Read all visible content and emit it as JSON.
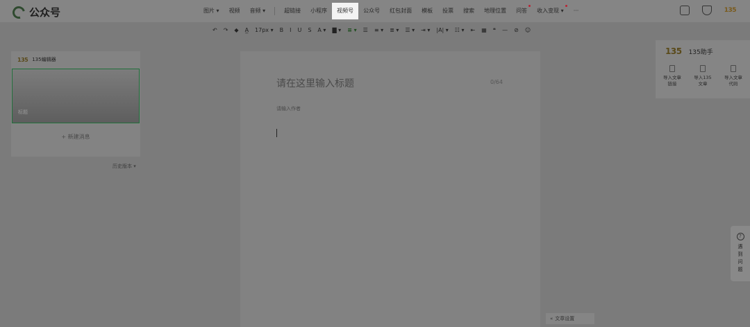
{
  "app": {
    "title": "公众号"
  },
  "menu": {
    "items": [
      {
        "label": "图片",
        "caret": true
      },
      {
        "label": "视频"
      },
      {
        "label": "音频",
        "caret": true
      }
    ],
    "items2": [
      {
        "label": "超链接"
      },
      {
        "label": "小程序"
      },
      {
        "label": "视频号",
        "active": true
      },
      {
        "label": "公众号"
      },
      {
        "label": "红包封面"
      },
      {
        "label": "模板"
      },
      {
        "label": "投票"
      },
      {
        "label": "搜索"
      },
      {
        "label": "地理位置"
      },
      {
        "label": "问答",
        "dot": true
      },
      {
        "label": "收入变现",
        "caret": true,
        "dot": true
      },
      {
        "label": "···"
      }
    ]
  },
  "topright": {
    "brand": "135"
  },
  "toolbar": {
    "font_size": "17px",
    "items": [
      "↶",
      "↷",
      "◆",
      "A̲",
      "17px ▾",
      "B",
      "I",
      "U",
      "S",
      "A ▾",
      "▇ ▾",
      "≡ ▾",
      "☰",
      "≡ ▾",
      "≣ ▾",
      "☰ ▾",
      "⇥ ▾",
      "|A| ▾",
      "☷ ▾",
      "⇤",
      "▦",
      "❝",
      "—",
      "⊘",
      "☺"
    ]
  },
  "left_panel": {
    "brand": "135",
    "header": "135编辑器",
    "card_label": "标题",
    "new_message": "+ 新建消息",
    "history": "历史版本 ▾"
  },
  "editor": {
    "title_placeholder": "请在这里输入标题",
    "title_count": "0/64",
    "author_placeholder": "请输入作者"
  },
  "assistant": {
    "brand": "135",
    "title": "135助手",
    "items": [
      {
        "line1": "导入文章",
        "line2": "链接"
      },
      {
        "line1": "导入135",
        "line2": "文章"
      },
      {
        "line1": "导入文章",
        "line2": "代码"
      }
    ]
  },
  "help": {
    "label": "遇到问题"
  },
  "settings": {
    "label": "文章设置"
  }
}
